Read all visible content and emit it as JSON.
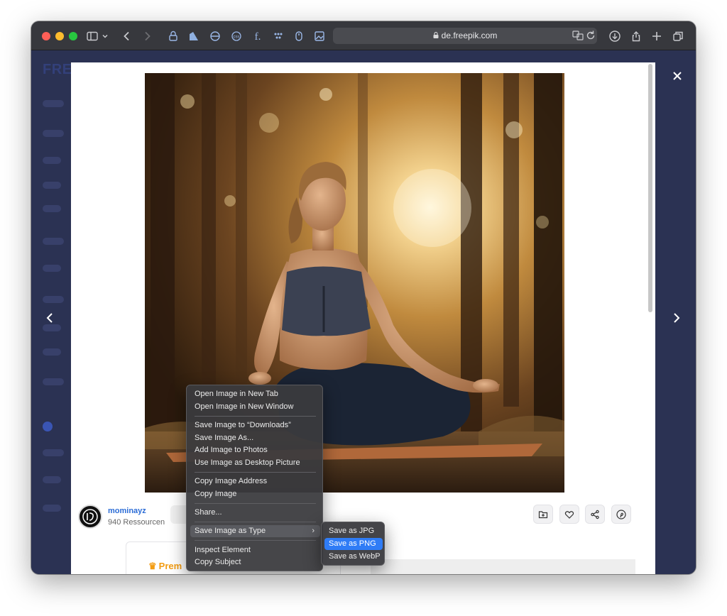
{
  "browser": {
    "url": "de.freepik.com",
    "toolbar_icons": [
      "sidebar-toggle-icon",
      "chevron-down-icon",
      "back-icon",
      "forward-icon",
      "password-icon",
      "extension-icon",
      "extension-icon",
      "extension-icon",
      "extension-icon",
      "extension-icon",
      "extension-icon",
      "extension-icon",
      "translate-icon",
      "reload-icon",
      "download-icon",
      "share-icon",
      "new-tab-icon",
      "tabs-overview-icon"
    ]
  },
  "page": {
    "brand_logo": "FREEPIK",
    "author": {
      "name": "mominayz",
      "resources": "940 Ressourcen"
    },
    "premium_label": "Prem",
    "actions": [
      "add-to-collection-icon",
      "heart-icon",
      "share-icon",
      "pinterest-icon"
    ]
  },
  "context_menu": {
    "items": [
      {
        "label": "Open Image in New Tab"
      },
      {
        "label": "Open Image in New Window"
      },
      {
        "label": "Save Image to “Downloads”"
      },
      {
        "label": "Save Image As..."
      },
      {
        "label": "Add Image to Photos"
      },
      {
        "label": "Use Image as Desktop Picture"
      },
      {
        "label": "Copy Image Address"
      },
      {
        "label": "Copy Image"
      },
      {
        "label": "Share..."
      },
      {
        "label": "Save Image as Type"
      },
      {
        "label": "Inspect Element"
      },
      {
        "label": "Copy Subject"
      }
    ],
    "submenu": {
      "items": [
        {
          "label": "Save as JPG"
        },
        {
          "label": "Save as PNG"
        },
        {
          "label": "Save as WebP"
        }
      ],
      "selected": "Save as PNG"
    }
  },
  "colors": {
    "accent_selection": "#2f7cf6",
    "author_link": "#2b6cd6",
    "premium": "#f39c12",
    "overlay_bg": "#2b3253"
  }
}
